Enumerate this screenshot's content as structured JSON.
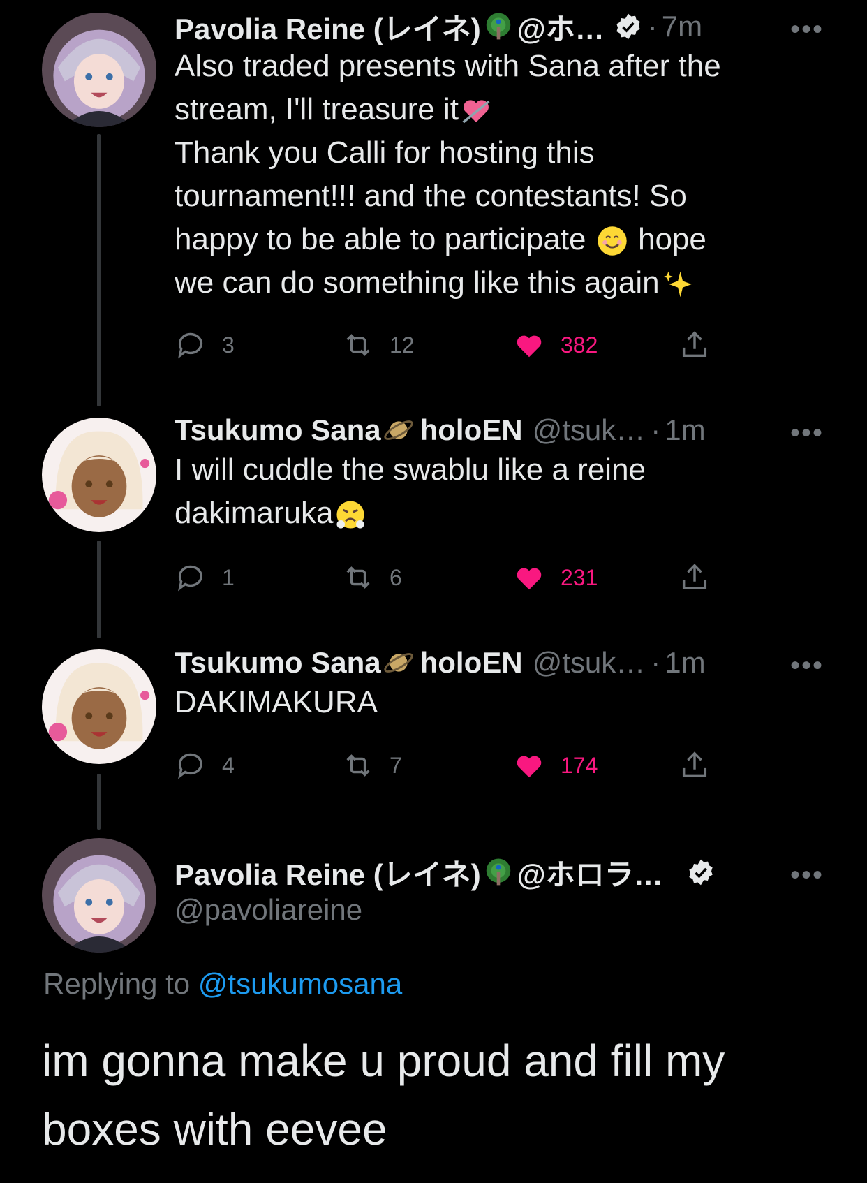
{
  "tweets": [
    {
      "author": "Pavolia Reine (レイネ)",
      "handle": "@ホ…",
      "verified": true,
      "time": "7m",
      "text_part1": "Also traded presents with Sana after the\nstream, I'll treasure it",
      "text_part2": "\nThank you Calli for hosting this\ntournament!!! and the contestants! So\nhappy to be able to participate ",
      "text_part3": " hope\nwe can do something like this again",
      "emoji_names": [
        "peacock-emoji",
        "heart-arrow-emoji",
        "smile-emoji",
        "sparkles-emoji"
      ],
      "replies": "3",
      "retweets": "12",
      "likes": "382"
    },
    {
      "author": "Tsukumo Sana",
      "author_suffix": "holoEN",
      "handle": "@tsuk…",
      "time": "1m",
      "text_part1": "I will cuddle the swablu like a reine\ndakimaruka",
      "emoji_names": [
        "ringed-planet-emoji",
        "triumph-face-emoji"
      ],
      "replies": "1",
      "retweets": "6",
      "likes": "231"
    },
    {
      "author": "Tsukumo Sana",
      "author_suffix": "holoEN",
      "handle": "@tsuk…",
      "time": "1m",
      "text_part1": "DAKIMAKURA",
      "emoji_names": [
        "ringed-planet-emoji"
      ],
      "replies": "4",
      "retweets": "7",
      "likes": "174"
    }
  ],
  "focus_tweet": {
    "author": "Pavolia Reine (レイネ)",
    "handle_short": "@ホロラ…",
    "handle": "@pavoliareine",
    "verified": true,
    "replying_label": "Replying to ",
    "replying_to": "@tsukumosana",
    "text": "im gonna make u proud and fill my boxes with eevee"
  },
  "colors": {
    "background": "#000000",
    "text": "#e7e9ea",
    "muted": "#71767b",
    "like": "#f91880",
    "link": "#1d9bf0"
  }
}
